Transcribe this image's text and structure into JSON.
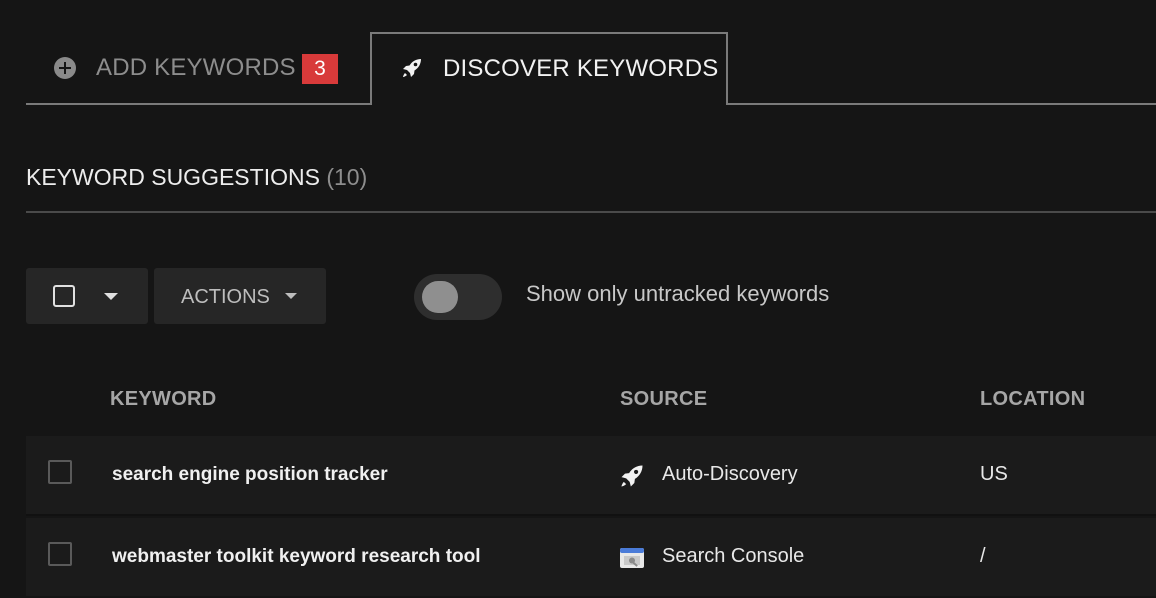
{
  "tabs": {
    "add": {
      "label": "ADD KEYWORDS",
      "badge": "3",
      "icon": "plus-circle-icon"
    },
    "discover": {
      "label": "DISCOVER KEYWORDS",
      "icon": "rocket-icon"
    }
  },
  "section": {
    "title": "KEYWORD SUGGESTIONS",
    "count": "(10)"
  },
  "toolbar": {
    "actions_label": "ACTIONS",
    "toggle_label": "Show only untracked keywords",
    "toggle_on": false
  },
  "table": {
    "columns": [
      "KEYWORD",
      "SOURCE",
      "LOCATION"
    ],
    "rows": [
      {
        "keyword": "search engine position tracker",
        "source": "Auto-Discovery",
        "source_icon": "rocket-icon",
        "location": "US"
      },
      {
        "keyword": "webmaster toolkit keyword research tool",
        "source": "Search Console",
        "source_icon": "search-console-icon",
        "location": "/"
      }
    ]
  },
  "colors": {
    "background": "#151515",
    "badge": "#d83a3a",
    "panel": "#262626"
  }
}
